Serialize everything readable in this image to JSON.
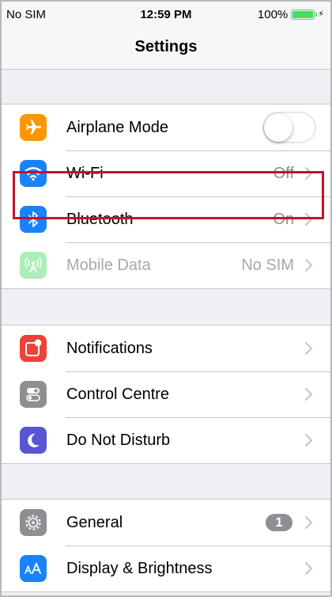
{
  "status_bar": {
    "carrier": "No SIM",
    "time": "12:59 PM",
    "battery_text": "100%",
    "battery_level": 1.0,
    "charging_icon": "bolt-icon"
  },
  "nav": {
    "title": "Settings"
  },
  "colors": {
    "airplane": "#ff9500",
    "wifi": "#1a82fb",
    "bluetooth": "#1a82fb",
    "mobile_data": "#4cd964",
    "notifications": "#f0403a",
    "control_centre": "#8e8e93",
    "do_not_disturb": "#5856d6",
    "general": "#8e8e93",
    "display": "#1a82fb",
    "highlight": "#c8102e"
  },
  "groups": {
    "connectivity": {
      "airplane": {
        "label": "Airplane Mode",
        "toggle_on": false,
        "icon": "airplane-icon"
      },
      "wifi": {
        "label": "Wi-Fi",
        "value": "Off",
        "icon": "wifi-icon"
      },
      "bluetooth": {
        "label": "Bluetooth",
        "value": "On",
        "icon": "bluetooth-icon"
      },
      "mobile_data": {
        "label": "Mobile Data",
        "value": "No SIM",
        "icon": "antenna-icon"
      }
    },
    "alerts": {
      "notifications": {
        "label": "Notifications",
        "icon": "notifications-icon"
      },
      "control_centre": {
        "label": "Control Centre",
        "icon": "control-centre-icon"
      },
      "do_not_disturb": {
        "label": "Do Not Disturb",
        "icon": "moon-icon"
      }
    },
    "device": {
      "general": {
        "label": "General",
        "badge": "1",
        "icon": "gear-icon"
      },
      "display": {
        "label": "Display & Brightness",
        "icon": "text-size-icon"
      }
    }
  }
}
